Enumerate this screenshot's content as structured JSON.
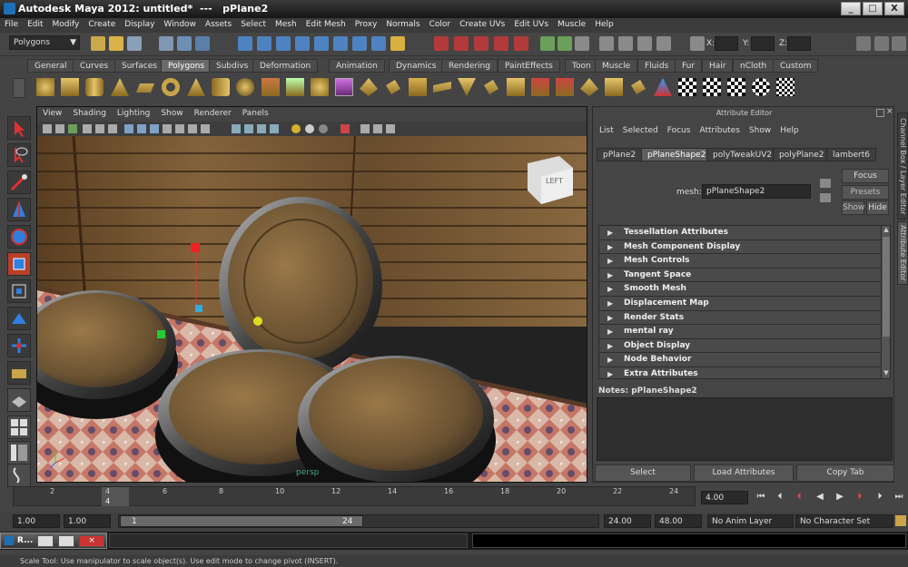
{
  "title": {
    "app": "Autodesk Maya 2012: untitled*",
    "sep": "---",
    "object": "pPlane2"
  },
  "window_buttons": [
    "_",
    "□",
    "X"
  ],
  "menus": [
    "File",
    "Edit",
    "Modify",
    "Create",
    "Display",
    "Window",
    "Assets",
    "Select",
    "Mesh",
    "Edit Mesh",
    "Proxy",
    "Normals",
    "Color",
    "Create UVs",
    "Edit UVs",
    "Muscle",
    "Help"
  ],
  "status": {
    "menu_set": "Polygons",
    "x_label": "X:",
    "y_label": "Y:",
    "z_label": "Z:"
  },
  "shelf_tabs": [
    "General",
    "Curves",
    "Surfaces",
    "Polygons",
    "Subdivs",
    "Deformation",
    "Animation",
    "Dynamics",
    "Rendering",
    "PaintEffects",
    "Toon",
    "Muscle",
    "Fluids",
    "Fur",
    "Hair",
    "nCloth",
    "Custom"
  ],
  "active_shelf": "Polygons",
  "viewport": {
    "menus": [
      "View",
      "Shading",
      "Lighting",
      "Show",
      "Renderer",
      "Panels"
    ],
    "camera_label": "persp",
    "viewcube": "LEFT"
  },
  "attr_editor": {
    "title": "Attribute Editor",
    "menus": [
      "List",
      "Selected",
      "Focus",
      "Attributes",
      "Show",
      "Help"
    ],
    "node_tabs": [
      "pPlane2",
      "pPlaneShape2",
      "polyTweakUV2",
      "polyPlane2",
      "lambert6"
    ],
    "active_tab": "pPlaneShape2",
    "mesh_label": "mesh:",
    "mesh_value": "pPlaneShape2",
    "focus": "Focus",
    "presets": "Presets",
    "show": "Show",
    "hide": "Hide",
    "sections": [
      "Tessellation Attributes",
      "Mesh Component Display",
      "Mesh Controls",
      "Tangent Space",
      "Smooth Mesh",
      "Displacement Map",
      "Render Stats",
      "mental ray",
      "Object Display",
      "Node Behavior",
      "Extra Attributes"
    ],
    "notes": "Notes:  pPlaneShape2",
    "buttons": [
      "Select",
      "Load Attributes",
      "Copy Tab"
    ]
  },
  "side_tabs": [
    "Channel Box / Layer Editor",
    "Attribute Editor"
  ],
  "timeline": {
    "ticks": [
      "2",
      "4",
      "6",
      "8",
      "10",
      "12",
      "14",
      "16",
      "18",
      "20",
      "22",
      "24"
    ],
    "current": "4",
    "current_field": "4.00"
  },
  "range": {
    "start": "1.00",
    "start2": "1.00",
    "slider_start": "1",
    "slider_end": "24",
    "end": "24.00",
    "end2": "48.00",
    "anim_layer": "No Anim Layer",
    "char_set": "No Character Set"
  },
  "taskbar": {
    "label": "R..."
  },
  "help_line": "Scale Tool: Use manipulator to scale object(s). Use edit mode to change pivot (INSERT)."
}
